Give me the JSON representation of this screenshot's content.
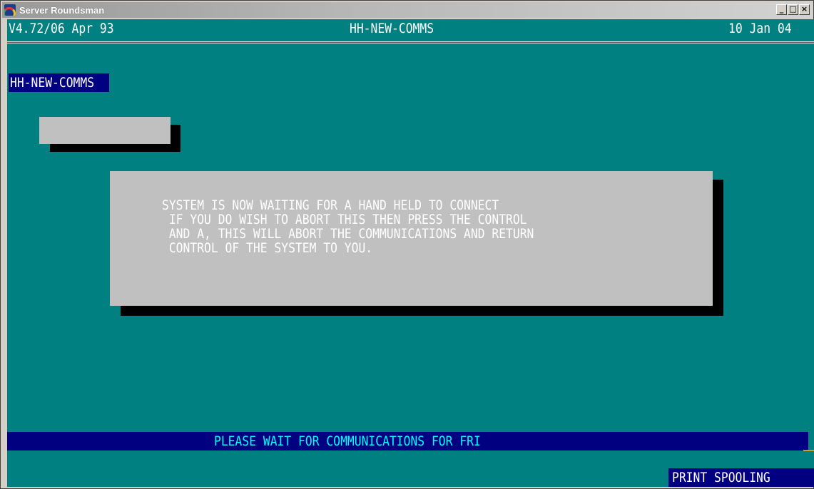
{
  "window": {
    "title": "Server Roundsman",
    "icon": "roundsman-app-icon",
    "controls": {
      "minimize": "_",
      "maximize": "□",
      "close": "×"
    }
  },
  "header": {
    "version": "V4.72/06 Apr 93",
    "program": "HH-NEW-COMMS",
    "date": "10 Jan 04"
  },
  "screen_name": "HH-NEW-COMMS",
  "message": {
    "lines": [
      "SYSTEM IS NOW WAITING FOR A HAND HELD TO CONNECT",
      " IF YOU DO WISH TO ABORT THIS THEN PRESS THE CONTROL",
      " AND A, THIS WILL ABORT THE COMMUNICATIONS AND RETURN",
      " CONTROL OF THE SYSTEM TO YOU."
    ]
  },
  "status": {
    "text": "PLEASE WAIT FOR COMMUNICATIONS FOR FRI",
    "indicator": "PRINT SPOOLING"
  },
  "colors": {
    "background": "#008080",
    "highlight_bar": "#000080",
    "panel": "#c0c0c0",
    "status_text": "#00ffff",
    "text": "#ffffff"
  }
}
